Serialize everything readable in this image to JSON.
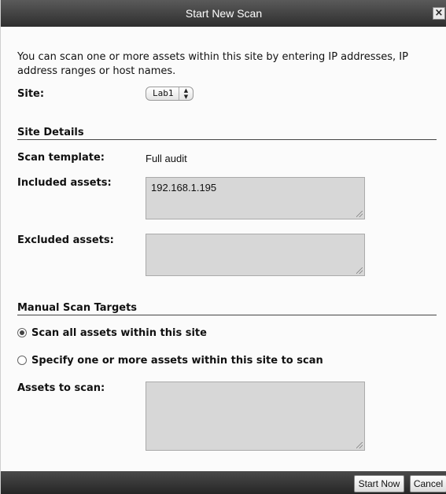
{
  "dialog": {
    "title": "Start New Scan",
    "close_label": "×"
  },
  "intro": "You can scan one or more assets within this site by entering IP addresses, IP address ranges or host names.",
  "site": {
    "label": "Site:",
    "selected": "Lab1",
    "arrows": "▲▼"
  },
  "site_details": {
    "heading": "Site Details",
    "template_label": "Scan template:",
    "template_value": "Full audit",
    "included_label": "Included assets:",
    "included_value": "192.168.1.195",
    "excluded_label": "Excluded assets:",
    "excluded_value": ""
  },
  "manual": {
    "heading": "Manual Scan Targets",
    "option_all": "Scan all assets within this site",
    "option_specify": "Specify one or more assets within this site to scan",
    "selected_option": "all",
    "assets_label": "Assets to scan:",
    "assets_value": ""
  },
  "footer": {
    "start_label": "Start Now",
    "cancel_label": "Cancel"
  }
}
